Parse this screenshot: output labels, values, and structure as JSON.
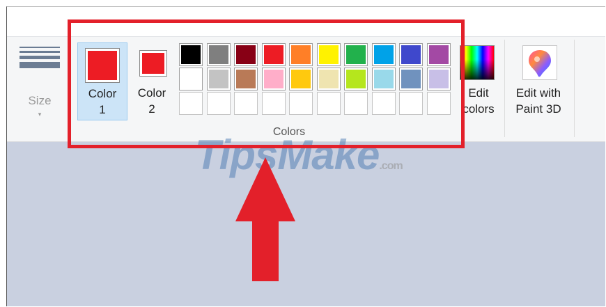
{
  "ribbon": {
    "size": {
      "label": "Size",
      "dropdown": "▾"
    },
    "color1": {
      "label_line1": "Color",
      "label_line2": "1",
      "color": "#ed1c24",
      "selected": true
    },
    "color2": {
      "label_line1": "Color",
      "label_line2": "2",
      "color": "#ed1c24"
    },
    "palette": {
      "row1": [
        "#000000",
        "#7f7f7f",
        "#880015",
        "#ed1c24",
        "#ff7f27",
        "#fff200",
        "#22b14c",
        "#00a2e8",
        "#3f48cc",
        "#a349a4"
      ],
      "row2": [
        "#ffffff",
        "#c3c3c3",
        "#b97a57",
        "#ffaec9",
        "#ffc90e",
        "#efe4b0",
        "#b5e61d",
        "#99d9ea",
        "#7092be",
        "#c8bfe7"
      ],
      "row3_empty_count": 10
    },
    "group_label": "Colors",
    "edit_colors": {
      "label_line1": "Edit",
      "label_line2": "colors"
    },
    "edit_paint3d": {
      "label_line1": "Edit with",
      "label_line2": "Paint 3D"
    }
  },
  "watermark": {
    "text": "TipsMake",
    "domain": ".com"
  },
  "annotation": {
    "highlight_color": "#e3202a",
    "arrow_color": "#e3202a"
  }
}
